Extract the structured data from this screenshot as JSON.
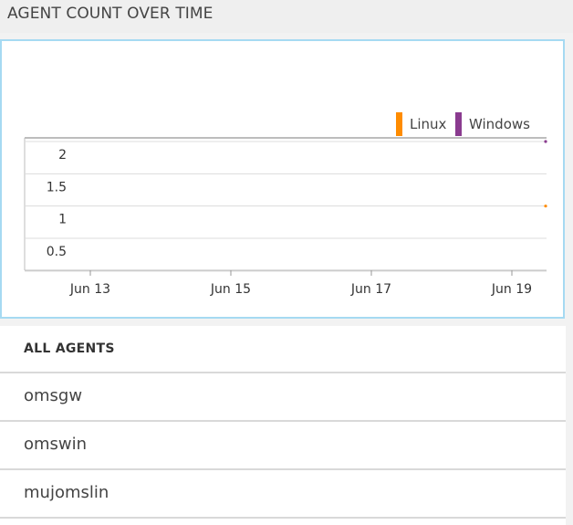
{
  "header": {
    "title": "AGENT COUNT OVER TIME"
  },
  "chart_data": {
    "type": "line",
    "title": "",
    "xlabel": "",
    "ylabel": "",
    "x_ticks": [
      "Jun 13",
      "Jun 15",
      "Jun 17",
      "Jun 19"
    ],
    "y_ticks": [
      "2",
      "1.5",
      "1",
      "0.5"
    ],
    "ylim": [
      0.5,
      2
    ],
    "grid": true,
    "legend": "top-right",
    "series": [
      {
        "name": "Linux",
        "color": "#ff8c00",
        "points": [
          {
            "x": "Jun 20",
            "y": 1
          }
        ]
      },
      {
        "name": "Windows",
        "color": "#8a3b8f",
        "points": [
          {
            "x": "Jun 20",
            "y": 2
          }
        ]
      }
    ]
  },
  "agents": {
    "header_label": "ALL AGENTS",
    "rows": [
      "omsgw",
      "omswin",
      "mujomslin"
    ]
  }
}
